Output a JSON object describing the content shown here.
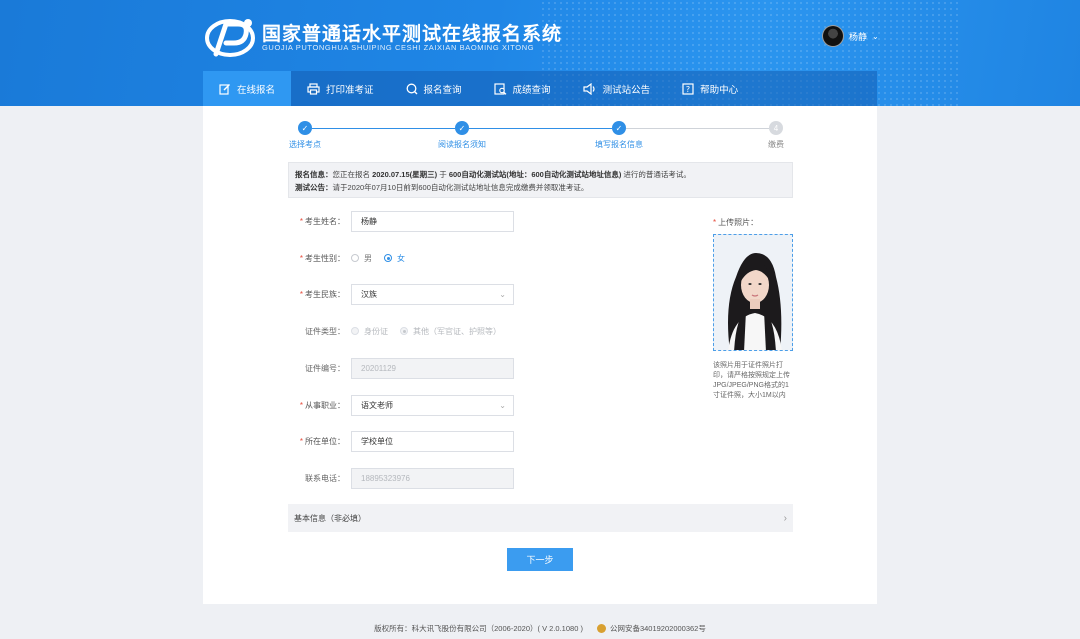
{
  "header": {
    "title": "国家普通话水平测试在线报名系统",
    "subtitle": "GUOJIA PUTONGHUA SHUIPING CESHI ZAIXIAN BAOMING XITONG",
    "user_name": "杨静"
  },
  "nav": [
    {
      "label": "在线报名",
      "icon": "edit-icon",
      "active": true
    },
    {
      "label": "打印准考证",
      "icon": "printer-icon",
      "active": false
    },
    {
      "label": "报名查询",
      "icon": "search-icon",
      "active": false
    },
    {
      "label": "成绩查询",
      "icon": "score-search-icon",
      "active": false
    },
    {
      "label": "测试站公告",
      "icon": "speaker-icon",
      "active": false
    },
    {
      "label": "帮助中心",
      "icon": "help-icon",
      "active": false
    }
  ],
  "steps": [
    {
      "label": "选择考点",
      "status": "done"
    },
    {
      "label": "阅读报名须知",
      "status": "done"
    },
    {
      "label": "填写报名信息",
      "status": "current"
    },
    {
      "label": "缴费",
      "status": "pending",
      "number": "4"
    }
  ],
  "info": {
    "line1_prefix": "报名信息：",
    "line1_a": "您正在报名 ",
    "line1_date": "2020.07.15(星期三)",
    "line1_b": " 于 ",
    "line1_site": "600自动化测试站(地址：600自动化测试站地址信息)",
    "line1_c": " 进行的普通话考试。",
    "line2_prefix": "测试公告：",
    "line2_text": "请于2020年07月10日前到600自动化测试站地址信息完成缴费并领取准考证。"
  },
  "form": {
    "name_label": "考生姓名：",
    "name_value": "杨静",
    "gender_label": "考生性别：",
    "gender_male": "男",
    "gender_female": "女",
    "ethnic_label": "考生民族：",
    "ethnic_value": "汉族",
    "idtype_label": "证件类型：",
    "idtype_opt1": "身份证",
    "idtype_opt2": "其他（军官证、护照等）",
    "idnum_label": "证件编号：",
    "idnum_value": "20201129",
    "job_label": "从事职业：",
    "job_value": "语文老师",
    "unit_label": "所在单位：",
    "unit_value": "学校单位",
    "phone_label": "联系电话：",
    "phone_value": "18895323976"
  },
  "photo": {
    "label": "上传照片：",
    "tip": "该照片用于证件照片打印，请严格按照规定上传JPG/JPEG/PNG格式的1寸证件照，大小1M以内"
  },
  "collapse_label": "基本信息（非必填）",
  "next_button": "下一步",
  "footer": {
    "copyright": "版权所有：科大讯飞股份有限公司（2006-2020）( V 2.0.1080 )",
    "police": "公网安备34019202000362号"
  },
  "colors": {
    "primary": "#2f8fe6",
    "header": "#1f86e6",
    "required": "#e74c3c"
  }
}
